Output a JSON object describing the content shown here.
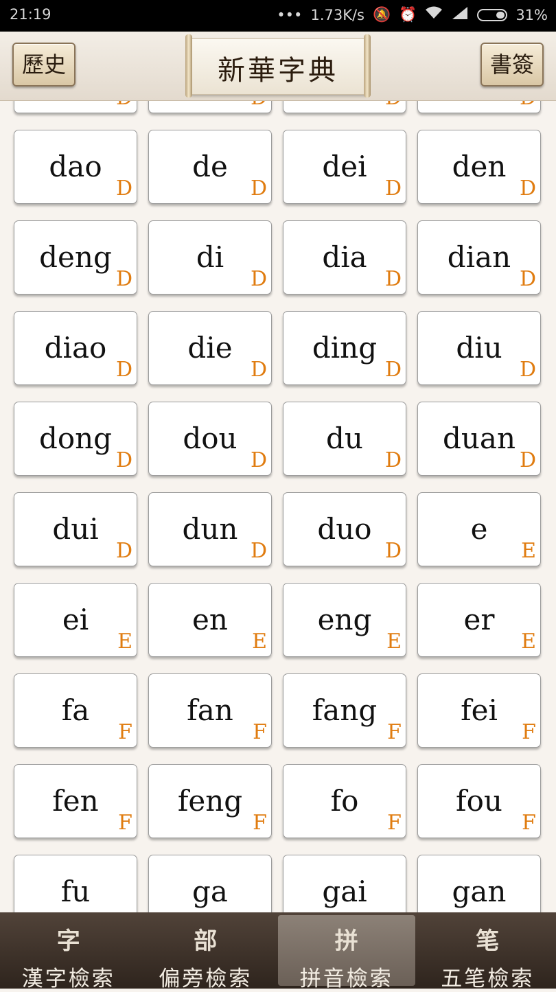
{
  "status_bar": {
    "time": "21:19",
    "network_speed": "1.73K/s",
    "battery": "31%"
  },
  "header": {
    "history_label": "歷史",
    "title": "新華字典",
    "bookmark_label": "書簽"
  },
  "grid": [
    {
      "pinyin": "",
      "letter": "D"
    },
    {
      "pinyin": "",
      "letter": "D"
    },
    {
      "pinyin": "",
      "letter": "D"
    },
    {
      "pinyin": "",
      "letter": "D"
    },
    {
      "pinyin": "dao",
      "letter": "D"
    },
    {
      "pinyin": "de",
      "letter": "D"
    },
    {
      "pinyin": "dei",
      "letter": "D"
    },
    {
      "pinyin": "den",
      "letter": "D"
    },
    {
      "pinyin": "deng",
      "letter": "D"
    },
    {
      "pinyin": "di",
      "letter": "D"
    },
    {
      "pinyin": "dia",
      "letter": "D"
    },
    {
      "pinyin": "dian",
      "letter": "D"
    },
    {
      "pinyin": "diao",
      "letter": "D"
    },
    {
      "pinyin": "die",
      "letter": "D"
    },
    {
      "pinyin": "ding",
      "letter": "D"
    },
    {
      "pinyin": "diu",
      "letter": "D"
    },
    {
      "pinyin": "dong",
      "letter": "D"
    },
    {
      "pinyin": "dou",
      "letter": "D"
    },
    {
      "pinyin": "du",
      "letter": "D"
    },
    {
      "pinyin": "duan",
      "letter": "D"
    },
    {
      "pinyin": "dui",
      "letter": "D"
    },
    {
      "pinyin": "dun",
      "letter": "D"
    },
    {
      "pinyin": "duo",
      "letter": "D"
    },
    {
      "pinyin": "e",
      "letter": "E"
    },
    {
      "pinyin": "ei",
      "letter": "E"
    },
    {
      "pinyin": "en",
      "letter": "E"
    },
    {
      "pinyin": "eng",
      "letter": "E"
    },
    {
      "pinyin": "er",
      "letter": "E"
    },
    {
      "pinyin": "fa",
      "letter": "F"
    },
    {
      "pinyin": "fan",
      "letter": "F"
    },
    {
      "pinyin": "fang",
      "letter": "F"
    },
    {
      "pinyin": "fei",
      "letter": "F"
    },
    {
      "pinyin": "fen",
      "letter": "F"
    },
    {
      "pinyin": "feng",
      "letter": "F"
    },
    {
      "pinyin": "fo",
      "letter": "F"
    },
    {
      "pinyin": "fou",
      "letter": "F"
    },
    {
      "pinyin": "fu",
      "letter": ""
    },
    {
      "pinyin": "ga",
      "letter": ""
    },
    {
      "pinyin": "gai",
      "letter": ""
    },
    {
      "pinyin": "gan",
      "letter": ""
    }
  ],
  "tabs": [
    {
      "icon": "字",
      "label": "漢字檢索",
      "active": false
    },
    {
      "icon": "部",
      "label": "偏旁檢索",
      "active": false
    },
    {
      "icon": "拼",
      "label": "拼音檢索",
      "active": true
    },
    {
      "icon": "笔",
      "label": "五笔檢索",
      "active": false
    }
  ],
  "colors": {
    "letter_accent": "#e07c10",
    "tabbar_bg": "#3d3129"
  }
}
